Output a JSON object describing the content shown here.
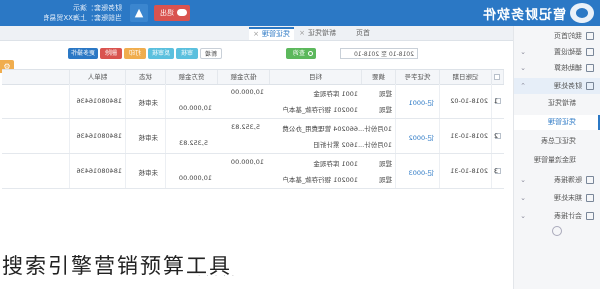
{
  "header": {
    "brand": "管记财务软件",
    "account_line1": "财务账套：演示",
    "account_line2": "当前账套：上海XX贸易有限公司",
    "notify_icon": "bell-icon",
    "exit_label": "退出",
    "colors": {
      "header_bg": "#2b78c5",
      "exit_bg": "#d9534f"
    }
  },
  "sidebar": {
    "items": [
      {
        "label": "我的首页",
        "icon": "home-icon"
      },
      {
        "label": "基础设置",
        "icon": "settings-icon",
        "chevron": "⌄"
      },
      {
        "label": "辅助核算",
        "icon": "tag-icon",
        "chevron": "⌄"
      },
      {
        "label": "财务处理",
        "icon": "ledger-icon",
        "chevron": "⌃",
        "open": true
      },
      {
        "label": "账簿报表",
        "icon": "book-icon",
        "chevron": "⌄"
      },
      {
        "label": "期末处理",
        "icon": "calendar-icon",
        "chevron": "⌄"
      },
      {
        "label": "会计报表",
        "icon": "report-icon",
        "chevron": "⌄"
      }
    ],
    "sub_items": [
      {
        "label": "新增凭证"
      },
      {
        "label": "凭证管理",
        "active": true
      },
      {
        "label": "凭证汇总表"
      },
      {
        "label": "现金流量管理"
      }
    ]
  },
  "tabs": [
    {
      "label": "首页"
    },
    {
      "label": "新增凭证",
      "closable": true
    },
    {
      "label": "凭证管理",
      "closable": true,
      "active": true
    }
  ],
  "toolbar": {
    "date_range": "2018-10 至 2018-10",
    "search_label": "查询",
    "buttons": [
      {
        "label": "新增",
        "color": "#ffffff",
        "style": "white"
      },
      {
        "label": "审核",
        "color": "#5bc0de"
      },
      {
        "label": "反审核",
        "color": "#5bc0de"
      },
      {
        "label": "打印",
        "color": "#f0ad4e"
      },
      {
        "label": "删除",
        "color": "#d9534f"
      },
      {
        "label": "更多操作",
        "color": "#2b78c5"
      }
    ],
    "float_icon": "gear-icon"
  },
  "table": {
    "columns": [
      "",
      "记账日期",
      "凭证字号",
      "摘要",
      "科目",
      "借方金额",
      "贷方金额",
      "状态",
      "制单人"
    ],
    "rows": [
      {
        "index": "1",
        "date": "2018-10-02",
        "voucher_no": "记-0001",
        "lines": [
          {
            "summary": "提现",
            "subject": "1001 库存现金",
            "debit": "10,000.00",
            "credit": ""
          },
          {
            "summary": "提现",
            "subject": "100201 银行存款_基本户",
            "debit": "",
            "credit": "10,000.00"
          }
        ],
        "status": "未审核",
        "maker": "18408016436"
      },
      {
        "index": "2",
        "date": "2018-10-31",
        "voucher_no": "记-0002",
        "lines": [
          {
            "summary": "10月份计...",
            "subject": "660204 管理费用_办公费",
            "debit": "5,352.83",
            "credit": ""
          },
          {
            "summary": "10月份计...",
            "subject": "1602 累计折旧",
            "debit": "",
            "credit": "5,352.83"
          }
        ],
        "status": "未审核",
        "maker": "18408016436"
      },
      {
        "index": "3",
        "date": "2018-10-31",
        "voucher_no": "记-0003",
        "lines": [
          {
            "summary": "提现",
            "subject": "1001 库存现金",
            "debit": "10,000.00",
            "credit": ""
          },
          {
            "summary": "提现",
            "subject": "100201 银行存款_基本户",
            "debit": "",
            "credit": "10,000.00"
          }
        ],
        "status": "未审核",
        "maker": "18408016436"
      }
    ]
  },
  "pager": {
    "dots": "· · · · ·"
  },
  "caption": "搜索引擎营销预算工具"
}
